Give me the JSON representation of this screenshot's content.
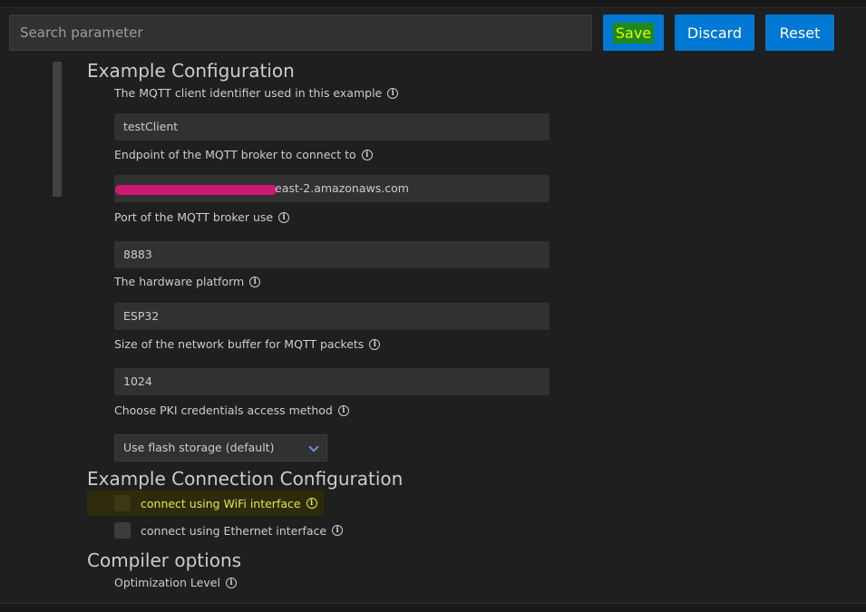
{
  "toolbar": {
    "search_placeholder": "Search parameter",
    "save_label": "Save",
    "discard_label": "Discard",
    "reset_label": "Reset"
  },
  "sections": {
    "example_config": {
      "title": "Example Configuration",
      "client_id_label": "The MQTT client identifier used in this example",
      "client_id_value": "testClient",
      "endpoint_label": "Endpoint of the MQTT broker to connect to",
      "endpoint_value_visible": "east-2.amazonaws.com",
      "port_label": "Port of the MQTT broker use",
      "port_value": "8883",
      "platform_label": "The hardware platform",
      "platform_value": "ESP32",
      "buffer_label": "Size of the network buffer for MQTT packets",
      "buffer_value": "1024",
      "pki_label": "Choose PKI credentials access method",
      "pki_value": "Use flash storage (default)"
    },
    "connection_config": {
      "title": "Example Connection Configuration",
      "wifi_label": "connect using WiFi interface",
      "ethernet_label": "connect using Ethernet interface"
    },
    "compiler": {
      "title": "Compiler options",
      "optimization_label": "Optimization Level"
    }
  },
  "info_glyph": "i",
  "icons": {
    "info": "info-icon",
    "dropdown": "chevron-down-icon"
  },
  "colors": {
    "background": "#1f1f1f",
    "input_background": "#313131",
    "button_blue": "#0078d4",
    "highlight_yellow": "#e5e54a",
    "redaction": "#cf1775"
  }
}
